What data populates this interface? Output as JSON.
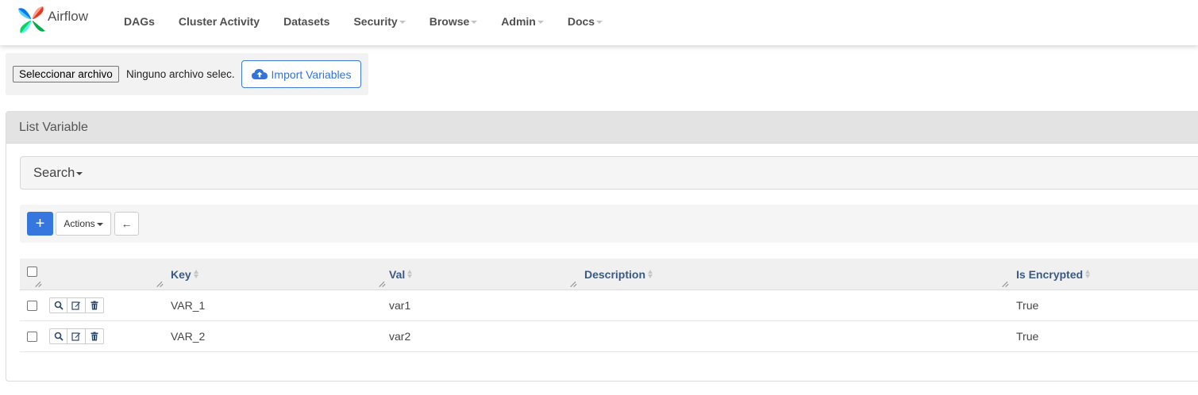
{
  "brand": {
    "name": "Airflow"
  },
  "nav": {
    "items": [
      {
        "label": "DAGs",
        "dropdown": false
      },
      {
        "label": "Cluster Activity",
        "dropdown": false
      },
      {
        "label": "Datasets",
        "dropdown": false
      },
      {
        "label": "Security",
        "dropdown": true
      },
      {
        "label": "Browse",
        "dropdown": true
      },
      {
        "label": "Admin",
        "dropdown": true
      },
      {
        "label": "Docs",
        "dropdown": true
      }
    ]
  },
  "import": {
    "file_button_label": "Seleccionar archivo",
    "file_status": "Ninguno archivo selec.",
    "import_button_label": "Import Variables",
    "icon": "cloud-upload-icon"
  },
  "list": {
    "title": "List Variable",
    "search_label": "Search",
    "toolbar": {
      "add_label": "+",
      "actions_label": "Actions",
      "back_icon": "←"
    },
    "columns": [
      "Key",
      "Val",
      "Description",
      "Is Encrypted"
    ],
    "rows": [
      {
        "key": "VAR_1",
        "val": "var1",
        "description": "",
        "is_encrypted": "True"
      },
      {
        "key": "VAR_2",
        "val": "var2",
        "description": "",
        "is_encrypted": "True"
      }
    ]
  },
  "colors": {
    "primary": "#3576df",
    "link_header": "#3a5a82",
    "nav_text": "#51504f"
  }
}
